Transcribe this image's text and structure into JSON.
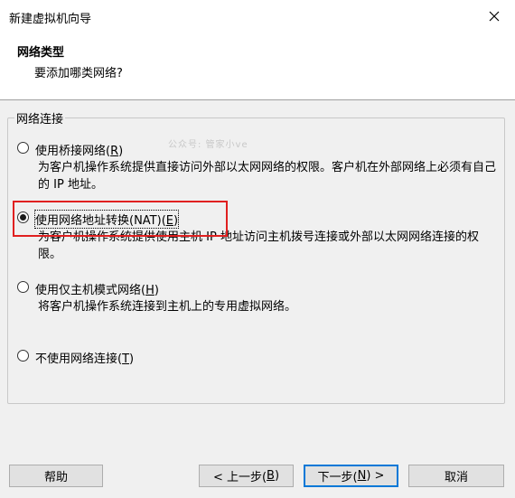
{
  "window": {
    "title": "新建虚拟机向导",
    "close_icon": "close-icon"
  },
  "header": {
    "title": "网络类型",
    "subtitle": "要添加哪类网络?"
  },
  "group": {
    "label": "网络连接"
  },
  "watermark": "公众号: 管家小ve",
  "options": [
    {
      "label_prefix": "使用桥接网络(",
      "mnemonic": "R",
      "label_suffix": ")",
      "desc": "为客户机操作系统提供直接访问外部以太网网络的权限。客户机在外部网络上必须有自己的 IP 地址。",
      "checked": false
    },
    {
      "label_prefix": "使用网络地址转换(NAT)(",
      "mnemonic": "E",
      "label_suffix": ")",
      "desc": "为客户机操作系统提供使用主机 IP 地址访问主机拨号连接或外部以太网网络连接的权限。",
      "checked": true,
      "highlight_color": "#e02020"
    },
    {
      "label_prefix": "使用仅主机模式网络(",
      "mnemonic": "H",
      "label_suffix": ")",
      "desc": "将客户机操作系统连接到主机上的专用虚拟网络。",
      "checked": false
    },
    {
      "label_prefix": "不使用网络连接(",
      "mnemonic": "T",
      "label_suffix": ")",
      "desc": "",
      "checked": false
    }
  ],
  "buttons": {
    "help": "帮助",
    "back_prefix": "< 上一步(",
    "back_mnemonic": "B",
    "back_suffix": ")",
    "next_prefix": "下一步(",
    "next_mnemonic": "N",
    "next_suffix": ") >",
    "cancel": "取消"
  },
  "colors": {
    "accent": "#0078d7",
    "highlight": "#e02020",
    "background": "#f0f0f0"
  }
}
